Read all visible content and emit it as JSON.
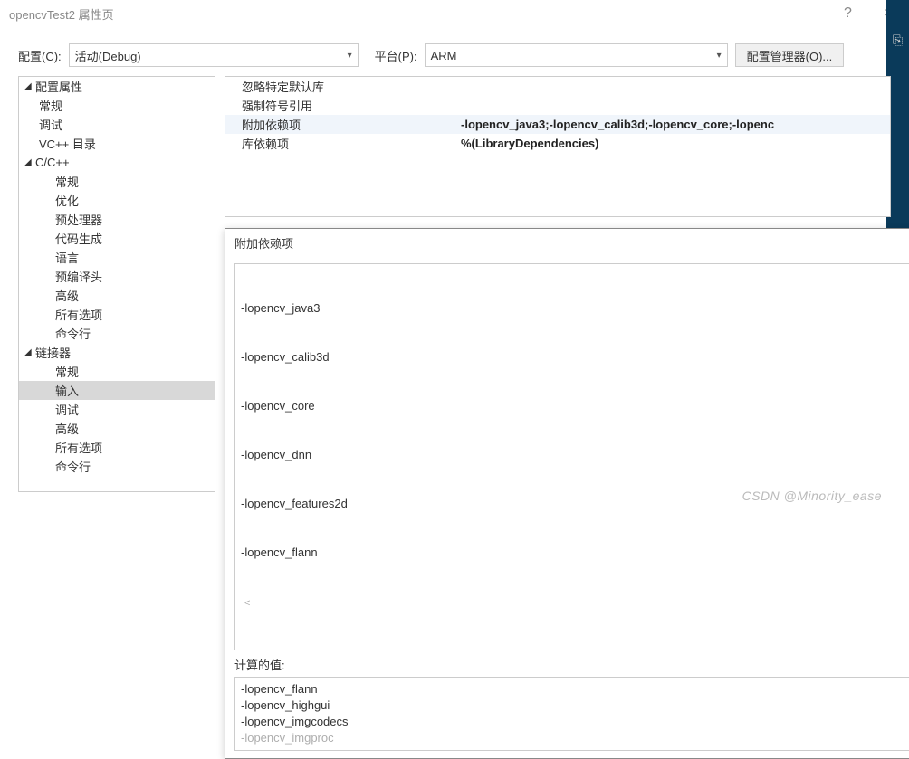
{
  "window": {
    "title": "opencvTest2 属性页",
    "help": "?",
    "close": "×"
  },
  "configRow": {
    "configLabel": "配置(C):",
    "configValue": "活动(Debug)",
    "platformLabel": "平台(P):",
    "platformValue": "ARM",
    "managerButton": "配置管理器(O)..."
  },
  "tree": {
    "root": "配置属性",
    "general": "常规",
    "debug": "调试",
    "vcDirs": "VC++ 目录",
    "cpp": "C/C++",
    "cpp_general": "常规",
    "cpp_opt": "优化",
    "cpp_prep": "预处理器",
    "cpp_codegen": "代码生成",
    "cpp_lang": "语言",
    "cpp_pch": "预编译头",
    "cpp_adv": "高级",
    "cpp_all": "所有选项",
    "cpp_cmd": "命令行",
    "linker": "链接器",
    "lk_general": "常规",
    "lk_input": "输入",
    "lk_debug": "调试",
    "lk_adv": "高级",
    "lk_all": "所有选项",
    "lk_cmd": "命令行"
  },
  "props": {
    "ignoreDefaultLib": "忽略特定默认库",
    "forceSymbolRef": "强制符号引用",
    "additionalDeps": "附加依赖项",
    "additionalDepsVal": "-lopencv_java3;-lopencv_calib3d;-lopencv_core;-lopenc",
    "libDeps": "库依赖项",
    "libDepsVal": "%(LibraryDependencies)"
  },
  "dialog": {
    "title": "附加依赖项",
    "help": "?",
    "lines": [
      "-lopencv_java3",
      "-lopencv_calib3d",
      "-lopencv_core",
      "-lopencv_dnn",
      "-lopencv_features2d",
      "-lopencv_flann"
    ],
    "scrollLeft": "<",
    "computedLabel": "计算的值:",
    "computedLines": [
      "-lopencv_flann",
      "-lopencv_highgui",
      "-lopencv_imgcodecs",
      "-lopencv_imgproc"
    ]
  },
  "watermark": "CSDN @Minority_ease"
}
